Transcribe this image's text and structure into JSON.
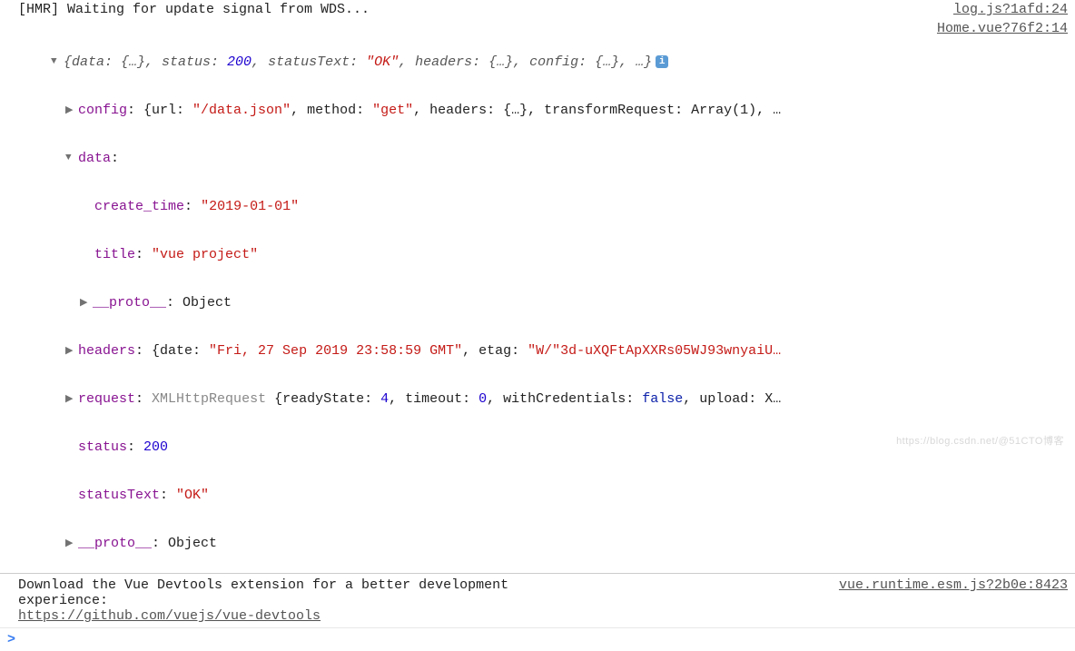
{
  "log1": {
    "text": "[HMR] Waiting for update signal from WDS...",
    "source": "log.js?1afd:24"
  },
  "log2": {
    "source": "Home.vue?76f2:14"
  },
  "obj": {
    "summary_pre": "{data: {…}, status: ",
    "summary_status": "200",
    "summary_mid1": ", statusText: ",
    "summary_statusText": "\"OK\"",
    "summary_mid2": ", headers: {…}, config: {…}, …}",
    "info": "i",
    "config": {
      "key": "config",
      "pre": ": {url: ",
      "url": "\"/data.json\"",
      "mid1": ", method: ",
      "method": "\"get\"",
      "mid2": ", headers: {…}, transformRequest: Array(1), …"
    },
    "data": {
      "key": "data",
      "colon": ":",
      "create_time_key": "create_time",
      "create_time_val": "\"2019-01-01\"",
      "title_key": "title",
      "title_val": "\"vue project\"",
      "proto_key": "__proto__",
      "proto_val": ": Object"
    },
    "headers": {
      "key": "headers",
      "pre": ": {date: ",
      "date": "\"Fri, 27 Sep 2019 23:58:59 GMT\"",
      "mid": ", etag: ",
      "etag": "\"W/\"3d-uXQFtApXXRs05WJ93wnyaiU…"
    },
    "request": {
      "key": "request",
      "pre": ": ",
      "cls": "XMLHttpRequest",
      "mid1": " {readyState: ",
      "readyState": "4",
      "mid2": ", timeout: ",
      "timeout": "0",
      "mid3": ", withCredentials: ",
      "withCredentials": "false",
      "mid4": ", upload: X…"
    },
    "status_key": "status",
    "status_val": "200",
    "statusText_key": "statusText",
    "statusText_val": "\"OK\"",
    "proto_key": "__proto__",
    "proto_val": ": Object"
  },
  "devtools": {
    "text1": "Download the Vue Devtools extension for a better development",
    "text2": "experience:",
    "link": "https://github.com/vuejs/vue-devtools",
    "source": "vue.runtime.esm.js?2b0e:8423"
  },
  "prompt": ">",
  "watermark": "https://blog.csdn.net/@51CTO博客"
}
